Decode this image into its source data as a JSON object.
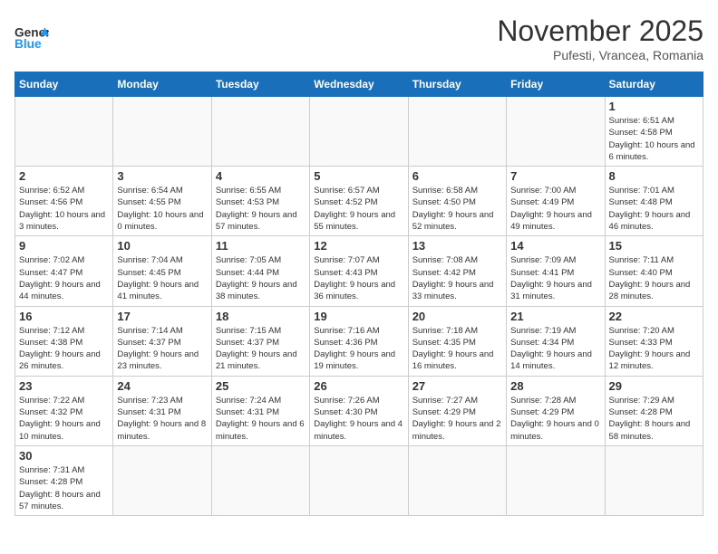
{
  "logo": {
    "text_general": "General",
    "text_blue": "Blue"
  },
  "title": "November 2025",
  "subtitle": "Pufesti, Vrancea, Romania",
  "days_header": [
    "Sunday",
    "Monday",
    "Tuesday",
    "Wednesday",
    "Thursday",
    "Friday",
    "Saturday"
  ],
  "weeks": [
    [
      {
        "day": "",
        "info": ""
      },
      {
        "day": "",
        "info": ""
      },
      {
        "day": "",
        "info": ""
      },
      {
        "day": "",
        "info": ""
      },
      {
        "day": "",
        "info": ""
      },
      {
        "day": "",
        "info": ""
      },
      {
        "day": "1",
        "info": "Sunrise: 6:51 AM\nSunset: 4:58 PM\nDaylight: 10 hours and 6 minutes."
      }
    ],
    [
      {
        "day": "2",
        "info": "Sunrise: 6:52 AM\nSunset: 4:56 PM\nDaylight: 10 hours and 3 minutes."
      },
      {
        "day": "3",
        "info": "Sunrise: 6:54 AM\nSunset: 4:55 PM\nDaylight: 10 hours and 0 minutes."
      },
      {
        "day": "4",
        "info": "Sunrise: 6:55 AM\nSunset: 4:53 PM\nDaylight: 9 hours and 57 minutes."
      },
      {
        "day": "5",
        "info": "Sunrise: 6:57 AM\nSunset: 4:52 PM\nDaylight: 9 hours and 55 minutes."
      },
      {
        "day": "6",
        "info": "Sunrise: 6:58 AM\nSunset: 4:50 PM\nDaylight: 9 hours and 52 minutes."
      },
      {
        "day": "7",
        "info": "Sunrise: 7:00 AM\nSunset: 4:49 PM\nDaylight: 9 hours and 49 minutes."
      },
      {
        "day": "8",
        "info": "Sunrise: 7:01 AM\nSunset: 4:48 PM\nDaylight: 9 hours and 46 minutes."
      }
    ],
    [
      {
        "day": "9",
        "info": "Sunrise: 7:02 AM\nSunset: 4:47 PM\nDaylight: 9 hours and 44 minutes."
      },
      {
        "day": "10",
        "info": "Sunrise: 7:04 AM\nSunset: 4:45 PM\nDaylight: 9 hours and 41 minutes."
      },
      {
        "day": "11",
        "info": "Sunrise: 7:05 AM\nSunset: 4:44 PM\nDaylight: 9 hours and 38 minutes."
      },
      {
        "day": "12",
        "info": "Sunrise: 7:07 AM\nSunset: 4:43 PM\nDaylight: 9 hours and 36 minutes."
      },
      {
        "day": "13",
        "info": "Sunrise: 7:08 AM\nSunset: 4:42 PM\nDaylight: 9 hours and 33 minutes."
      },
      {
        "day": "14",
        "info": "Sunrise: 7:09 AM\nSunset: 4:41 PM\nDaylight: 9 hours and 31 minutes."
      },
      {
        "day": "15",
        "info": "Sunrise: 7:11 AM\nSunset: 4:40 PM\nDaylight: 9 hours and 28 minutes."
      }
    ],
    [
      {
        "day": "16",
        "info": "Sunrise: 7:12 AM\nSunset: 4:38 PM\nDaylight: 9 hours and 26 minutes."
      },
      {
        "day": "17",
        "info": "Sunrise: 7:14 AM\nSunset: 4:37 PM\nDaylight: 9 hours and 23 minutes."
      },
      {
        "day": "18",
        "info": "Sunrise: 7:15 AM\nSunset: 4:37 PM\nDaylight: 9 hours and 21 minutes."
      },
      {
        "day": "19",
        "info": "Sunrise: 7:16 AM\nSunset: 4:36 PM\nDaylight: 9 hours and 19 minutes."
      },
      {
        "day": "20",
        "info": "Sunrise: 7:18 AM\nSunset: 4:35 PM\nDaylight: 9 hours and 16 minutes."
      },
      {
        "day": "21",
        "info": "Sunrise: 7:19 AM\nSunset: 4:34 PM\nDaylight: 9 hours and 14 minutes."
      },
      {
        "day": "22",
        "info": "Sunrise: 7:20 AM\nSunset: 4:33 PM\nDaylight: 9 hours and 12 minutes."
      }
    ],
    [
      {
        "day": "23",
        "info": "Sunrise: 7:22 AM\nSunset: 4:32 PM\nDaylight: 9 hours and 10 minutes."
      },
      {
        "day": "24",
        "info": "Sunrise: 7:23 AM\nSunset: 4:31 PM\nDaylight: 9 hours and 8 minutes."
      },
      {
        "day": "25",
        "info": "Sunrise: 7:24 AM\nSunset: 4:31 PM\nDaylight: 9 hours and 6 minutes."
      },
      {
        "day": "26",
        "info": "Sunrise: 7:26 AM\nSunset: 4:30 PM\nDaylight: 9 hours and 4 minutes."
      },
      {
        "day": "27",
        "info": "Sunrise: 7:27 AM\nSunset: 4:29 PM\nDaylight: 9 hours and 2 minutes."
      },
      {
        "day": "28",
        "info": "Sunrise: 7:28 AM\nSunset: 4:29 PM\nDaylight: 9 hours and 0 minutes."
      },
      {
        "day": "29",
        "info": "Sunrise: 7:29 AM\nSunset: 4:28 PM\nDaylight: 8 hours and 58 minutes."
      }
    ],
    [
      {
        "day": "30",
        "info": "Sunrise: 7:31 AM\nSunset: 4:28 PM\nDaylight: 8 hours and 57 minutes."
      },
      {
        "day": "",
        "info": ""
      },
      {
        "day": "",
        "info": ""
      },
      {
        "day": "",
        "info": ""
      },
      {
        "day": "",
        "info": ""
      },
      {
        "day": "",
        "info": ""
      },
      {
        "day": "",
        "info": ""
      }
    ]
  ]
}
